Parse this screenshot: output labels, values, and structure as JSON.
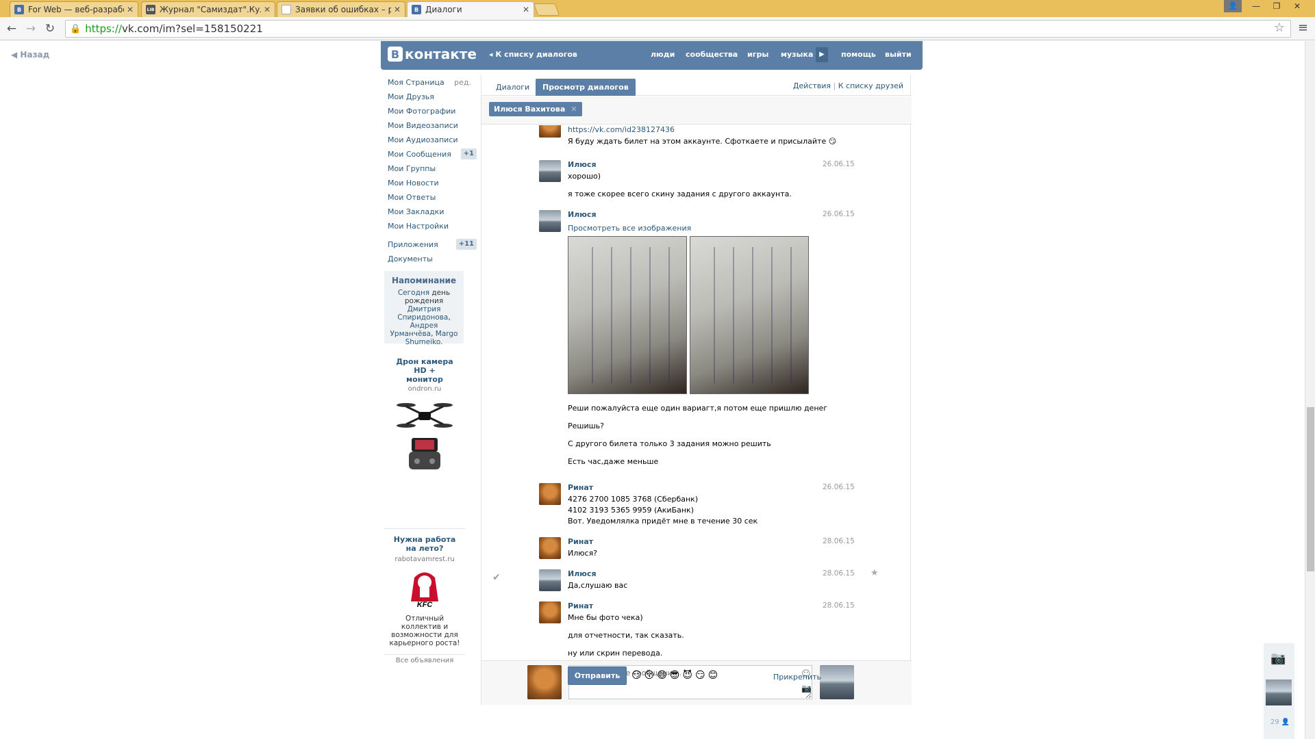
{
  "browser": {
    "tabs": [
      {
        "label": "For Web — веб-разрабо",
        "color": "#4a6fa5",
        "glyph": "B"
      },
      {
        "label": "Журнал \"Самиздат\".Кула",
        "color": "#555555",
        "glyph": "LIB"
      },
      {
        "label": "Заявки об ошибках – ре",
        "color": "#bbbbbb",
        "glyph": ""
      },
      {
        "label": "Диалоги",
        "color": "#4a6fa5",
        "glyph": "B"
      }
    ],
    "url_https": "https://",
    "url_rest": "vk.com/im?sel=158150221"
  },
  "page": {
    "back_link": "Назад"
  },
  "header": {
    "logo_text": "контакте",
    "back_to_dialogs": "К списку диалогов",
    "nav": [
      "люди",
      "сообщества",
      "игры",
      "музыка",
      "помощь",
      "выйти"
    ]
  },
  "left_menu": {
    "items": [
      {
        "label": "Моя Страница",
        "extra": "ред."
      },
      {
        "label": "Мои Друзья"
      },
      {
        "label": "Мои Фотографии"
      },
      {
        "label": "Мои Видеозаписи"
      },
      {
        "label": "Мои Аудиозаписи"
      },
      {
        "label": "Мои Сообщения",
        "badge": "+1"
      },
      {
        "label": "Мои Группы"
      },
      {
        "label": "Мои Новости"
      },
      {
        "label": "Мои Ответы"
      },
      {
        "label": "Мои Закладки"
      },
      {
        "label": "Мои Настройки"
      }
    ],
    "extra_items": [
      {
        "label": "Приложения",
        "badge": "+11"
      },
      {
        "label": "Документы"
      }
    ]
  },
  "reminder": {
    "title": "Напоминание",
    "today": "Сегодня",
    "birthday": "день рождения",
    "names1": "Дмитрия Спиридонова",
    "sep": ",",
    "names2": "Андрея Урманчёва",
    "names3": "Margo Shumeiko",
    "end": "."
  },
  "ads": [
    {
      "title": "Дрон камера HD + монитор",
      "domain": "ondron.ru"
    },
    {
      "title": "Нужна работа на лето?",
      "domain": "rabotavamrest.ru",
      "text": "Отличный коллектив и возможности для карьерного роста!"
    }
  ],
  "ads_all": "Все объявления",
  "dialog": {
    "tabs": [
      "Диалоги",
      "Просмотр диалогов"
    ],
    "actions": "Действия",
    "friends_link": "К списку друзей",
    "chip": "Илюся Вахитова",
    "messages": [
      {
        "author": "",
        "date": "",
        "lines": [
          "https://vk.com/id238127436",
          "Я буду ждать билет на этом аккаунте. Сфоткаете и присылайте 😏"
        ]
      },
      {
        "author": "Илюся",
        "date": "26.06.15",
        "lines": [
          "хорошо)",
          "я тоже скорее всего скину задания с другого аккаунта."
        ]
      },
      {
        "author": "Илюся",
        "date": "26.06.15",
        "lines": [
          "Просмотреть все изображения",
          "Реши пожалуйста еще один вариагт,я потом еще пришлю денег",
          "Решишь?",
          "С другого билета только 3 задания можно решить",
          "Есть час,даже меньше"
        ]
      },
      {
        "author": "Ринат",
        "date": "26.06.15",
        "lines": [
          "4276 2700 1085 3768 (Сбербанк)",
          "4102 3193 5365 9959 (АкиБанк)",
          "Вот. Уведомлялка придёт мне в течение 30 сек"
        ]
      },
      {
        "author": "Ринат",
        "date": "28.06.15",
        "lines": [
          "Илюся?"
        ]
      },
      {
        "author": "Илюся",
        "date": "28.06.15",
        "lines": [
          "Да,слушаю вас"
        ]
      },
      {
        "author": "Ринат",
        "date": "28.06.15",
        "lines": [
          "Мне бы фото чека)",
          "для отчетности, так сказать.",
          "ну или скрин перевода."
        ]
      }
    ],
    "input_placeholder": "Введите Ваше сообщение..",
    "send_label": "Отправить",
    "smiles": "😏😚😄😎😈😏😊",
    "attach_label": "Прикрепить"
  },
  "right_widget": {
    "count": "29"
  }
}
